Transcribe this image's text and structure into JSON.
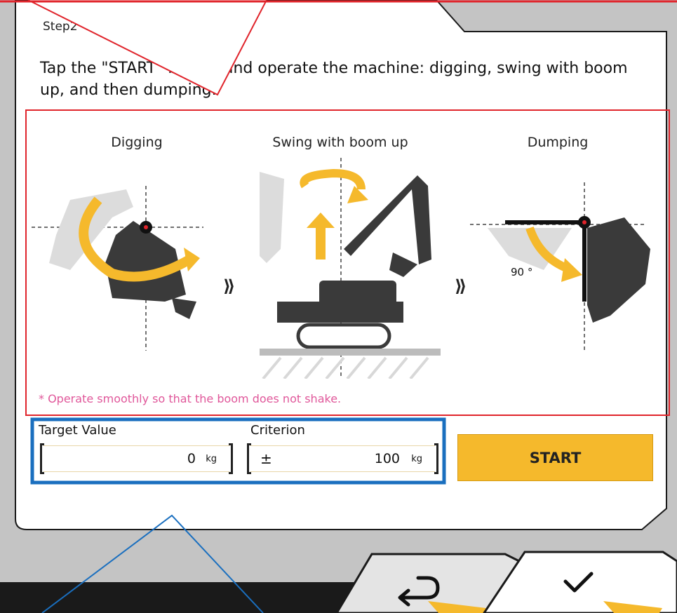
{
  "step": {
    "label": "Step2"
  },
  "instruction": "Tap the \"START\" button and operate the machine: digging, swing with boom up, and then dumping.",
  "phases": [
    {
      "label": "Digging"
    },
    {
      "label": "Swing with boom up"
    },
    {
      "label": "Dumping"
    }
  ],
  "angle_label": "90 °",
  "note": "* Operate smoothly so that the boom does not shake.",
  "target_value": {
    "label": "Target Value",
    "value": "0",
    "unit": "kg"
  },
  "criterion": {
    "label": "Criterion",
    "prefix": "±",
    "value": "100",
    "unit": "kg"
  },
  "start_button": {
    "label": "START"
  },
  "nav": {
    "back_icon": "return-arrow-icon",
    "confirm_icon": "checkmark-icon"
  },
  "colors": {
    "accent": "#f5b92c",
    "highlight_red": "#e0242b",
    "highlight_blue": "#1a6fbf",
    "note_pink": "#e0579a",
    "bottom_bar": "#1a1a1a"
  }
}
